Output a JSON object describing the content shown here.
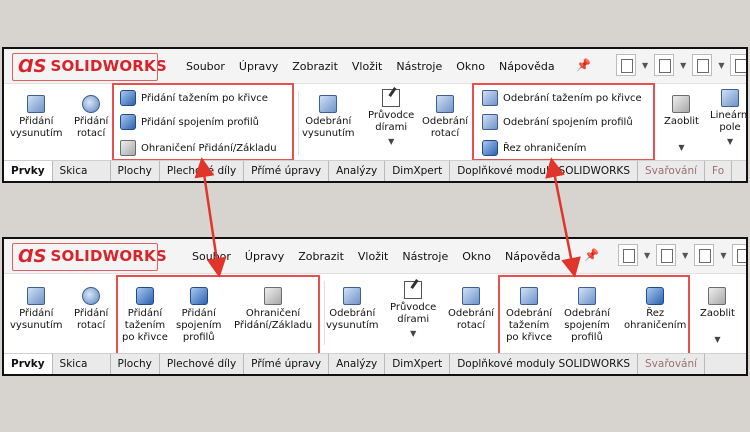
{
  "app": {
    "logo_mark": "ⱭS",
    "logo_solid": "SOLID",
    "logo_works": "WORKS"
  },
  "menu": [
    "Soubor",
    "Úpravy",
    "Zobrazit",
    "Vložit",
    "Nástroje",
    "Okno",
    "Nápověda"
  ],
  "top": {
    "extrude_boss": [
      "Přidání",
      "vysunutím"
    ],
    "revolve_boss": [
      "Přidání",
      "rotací"
    ],
    "group1": [
      "Přidání tažením po křivce",
      "Přidání spojením profilů",
      "Ohraničení Přidání/Základu"
    ],
    "extrude_cut": [
      "Odebrání",
      "vysunutím"
    ],
    "hole_wizard": [
      "Průvodce",
      "dírami"
    ],
    "revolve_cut": [
      "Odebrání",
      "rotací"
    ],
    "group2": [
      "Odebrání tažením po křivce",
      "Odebrání spojením profilů",
      "Řez ohraničením"
    ],
    "fillet": "Zaoblit",
    "linear_pattern": [
      "Lineární",
      "pole"
    ]
  },
  "bottom": {
    "extrude_boss": [
      "Přidání",
      "vysunutím"
    ],
    "revolve_boss": [
      "Přidání",
      "rotací"
    ],
    "sweep_boss": [
      "Přidání",
      "tažením",
      "po křivce"
    ],
    "loft_boss": [
      "Přidání",
      "spojením",
      "profilů"
    ],
    "boundary_boss": [
      "Ohraničení",
      "Přidání/Základu"
    ],
    "extrude_cut": [
      "Odebrání",
      "vysunutím"
    ],
    "hole_wizard": [
      "Průvodce",
      "dírami"
    ],
    "revolve_cut": [
      "Odebrání",
      "rotací"
    ],
    "sweep_cut": [
      "Odebrání",
      "tažením",
      "po křivce"
    ],
    "loft_cut": [
      "Odebrání",
      "spojením",
      "profilů"
    ],
    "boundary_cut": [
      "Řez",
      "ohraničením"
    ],
    "fillet": "Zaoblit"
  },
  "tabs_top": [
    "Prvky",
    "Skica",
    "Plochy",
    "Plechové díly",
    "Přímé úpravy",
    "Analýzy",
    "DimXpert",
    "Doplňkové moduly SOLIDWORKS",
    "Svařování",
    "Fo"
  ],
  "tabs_bottom": [
    "Prvky",
    "Skica",
    "Plochy",
    "Plechové díly",
    "Přímé úpravy",
    "Analýzy",
    "DimXpert",
    "Doplňkové moduly SOLIDWORKS",
    "Svařování"
  ],
  "colors": {
    "highlight": "#e85050",
    "arrow": "#e0352b",
    "brand": "#d8232a"
  }
}
